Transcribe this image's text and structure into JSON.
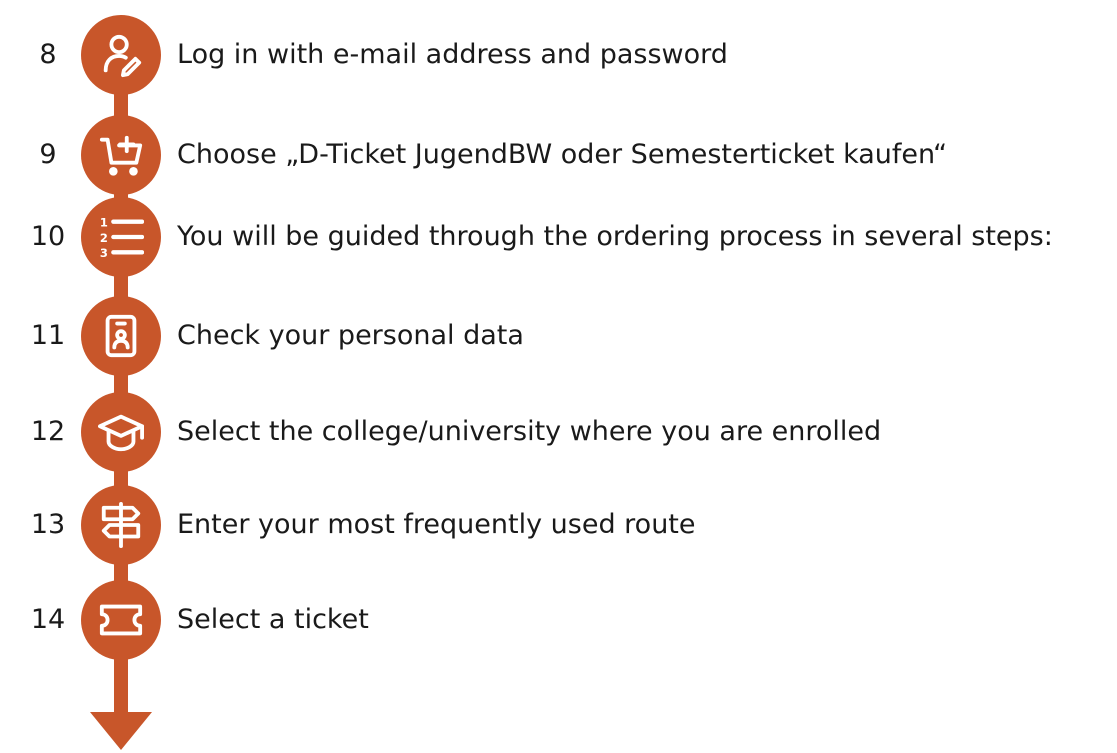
{
  "colors": {
    "accent": "#c8562a",
    "icon": "#ffffff",
    "text": "#1a1a1a"
  },
  "steps": [
    {
      "number": "8",
      "icon": "user-edit-icon",
      "text": "Log in with e-mail address and password"
    },
    {
      "number": "9",
      "icon": "cart-add-icon",
      "text": "Choose „D-Ticket JugendBW oder Semesterticket kaufen“"
    },
    {
      "number": "10",
      "icon": "numbered-list-icon",
      "text": "You will be guided through the ordering process in several steps:"
    },
    {
      "number": "11",
      "icon": "id-badge-icon",
      "text": "Check your personal data"
    },
    {
      "number": "12",
      "icon": "graduation-cap-icon",
      "text": "Select the college/university where you are enrolled"
    },
    {
      "number": "13",
      "icon": "signpost-icon",
      "text": "Enter your most frequently used route"
    },
    {
      "number": "14",
      "icon": "ticket-icon",
      "text": "Select a ticket"
    }
  ]
}
